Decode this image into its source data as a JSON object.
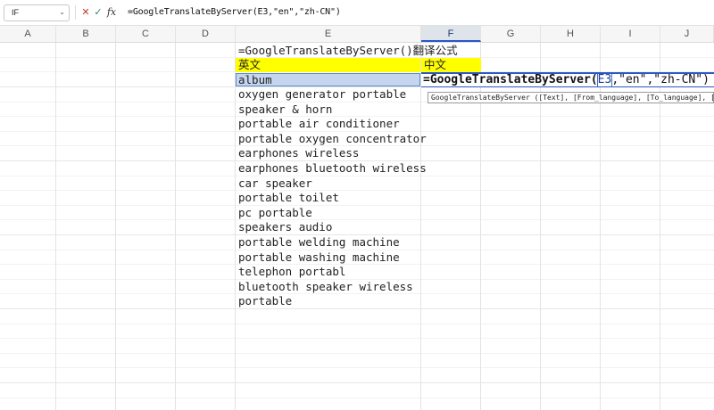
{
  "formula_bar": {
    "name_box": "IF",
    "cancel_icon": "✕",
    "enter_icon": "✓",
    "fx_label": "fx",
    "formula": "=GoogleTranslateByServer(E3,\"en\",\"zh-CN\")"
  },
  "columns": [
    "A",
    "B",
    "C",
    "D",
    "E",
    "F",
    "G",
    "H",
    "I",
    "J"
  ],
  "active_column": "F",
  "cells": {
    "e1": "=GoogleTranslateByServer()翻译公式",
    "e2": "英文",
    "f2": "中文",
    "e3": "album"
  },
  "editing_cell": {
    "func": "=GoogleTranslateByServer(",
    "ref": "E3",
    "args": ",\"en\",\"zh-CN\")"
  },
  "tooltip": "GoogleTranslateByServer ([Text], [From_language], [To_language], [Is_Api])",
  "list_items": [
    "oxygen generator portable",
    "speaker & horn",
    "portable air conditioner",
    "portable oxygen concentrator",
    "earphones wireless",
    "earphones bluetooth wireless",
    "car speaker",
    "portable toilet",
    "pc portable",
    "speakers audio",
    "portable welding machine",
    "portable washing machine",
    "telephon portabl",
    "bluetooth speaker wireless",
    "portable"
  ],
  "colors": {
    "header_fill": "#ffff00",
    "selection_fill": "#c6d5ee",
    "active_border": "#2a56c6"
  }
}
